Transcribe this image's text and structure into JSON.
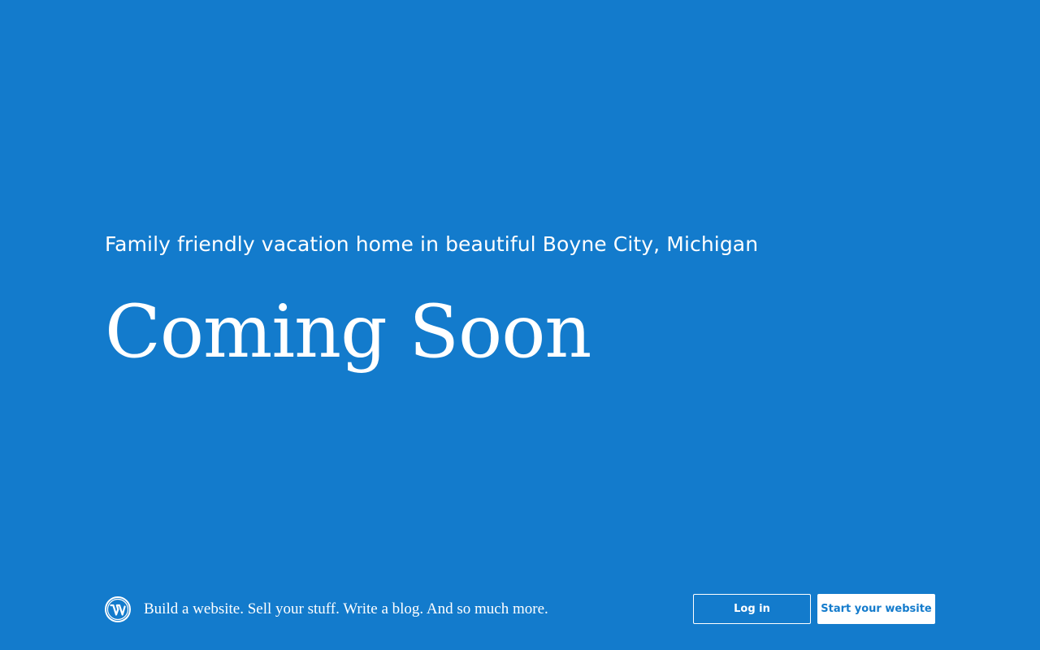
{
  "hero": {
    "tagline": "Family friendly vacation home in beautiful Boyne City, Michigan",
    "headline": "Coming Soon"
  },
  "footer": {
    "logo_icon": "wordpress-logo-icon",
    "text": "Build a website. Sell your stuff. Write a blog. And so much more.",
    "login_label": "Log in",
    "start_label": "Start your website"
  },
  "colors": {
    "background": "#137bcc",
    "text": "#ffffff"
  }
}
